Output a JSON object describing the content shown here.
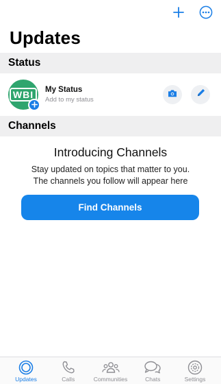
{
  "page_title": "Updates",
  "status": {
    "section_label": "Status",
    "avatar_text": "WBI",
    "name": "My Status",
    "subtitle": "Add to my status"
  },
  "channels": {
    "section_label": "Channels",
    "intro_title": "Introducing Channels",
    "intro_line_1": "Stay updated on topics that matter to you.",
    "intro_line_2": "The channels you follow will appear here",
    "find_button_label": "Find Channels"
  },
  "tabs": [
    {
      "label": "Updates",
      "icon": "updates-icon",
      "active": true
    },
    {
      "label": "Calls",
      "icon": "calls-icon",
      "active": false
    },
    {
      "label": "Communities",
      "icon": "communities-icon",
      "active": false
    },
    {
      "label": "Chats",
      "icon": "chats-icon",
      "active": false
    },
    {
      "label": "Settings",
      "icon": "settings-icon",
      "active": false
    }
  ],
  "colors": {
    "accent": "#1a7ee6",
    "avatar_bg": "#2fa56e",
    "section_bg": "#efeff0",
    "inactive_tab": "#8e8e93"
  }
}
